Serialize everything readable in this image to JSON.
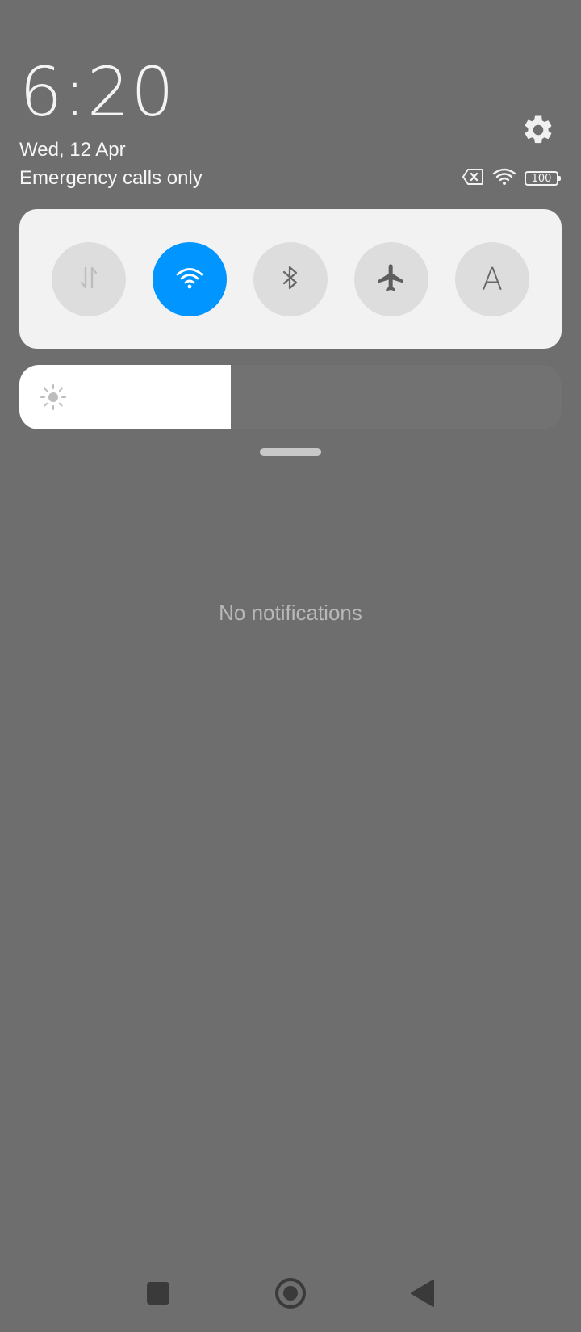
{
  "header": {
    "time": "6:20",
    "date": "Wed, 12 Apr",
    "carrier_status": "Emergency calls only",
    "battery_level": "100"
  },
  "quick_toggles": [
    {
      "name": "mobile-data",
      "icon": "data-arrows-icon",
      "active": false,
      "glyph": ""
    },
    {
      "name": "wifi",
      "icon": "wifi-icon",
      "active": true,
      "glyph": ""
    },
    {
      "name": "bluetooth",
      "icon": "bluetooth-icon",
      "active": false,
      "glyph": ""
    },
    {
      "name": "airplane-mode",
      "icon": "airplane-icon",
      "active": false,
      "glyph": ""
    },
    {
      "name": "auto-brightness",
      "icon": "auto-brightness-icon",
      "active": false,
      "glyph": "A"
    }
  ],
  "brightness": {
    "level_fraction": 0.39,
    "icon": "sun-icon"
  },
  "notifications": {
    "empty_text": "No notifications"
  },
  "navigation": {
    "recents_icon": "square-icon",
    "home_icon": "circle-home-icon",
    "back_icon": "triangle-back-icon"
  },
  "colors": {
    "background": "#6e6e6e",
    "card": "#f2f2f2",
    "toggle_inactive": "#dddddd",
    "toggle_active": "#0095ff",
    "brightness_fill": "#ffffff",
    "brightness_track": "#727272"
  }
}
